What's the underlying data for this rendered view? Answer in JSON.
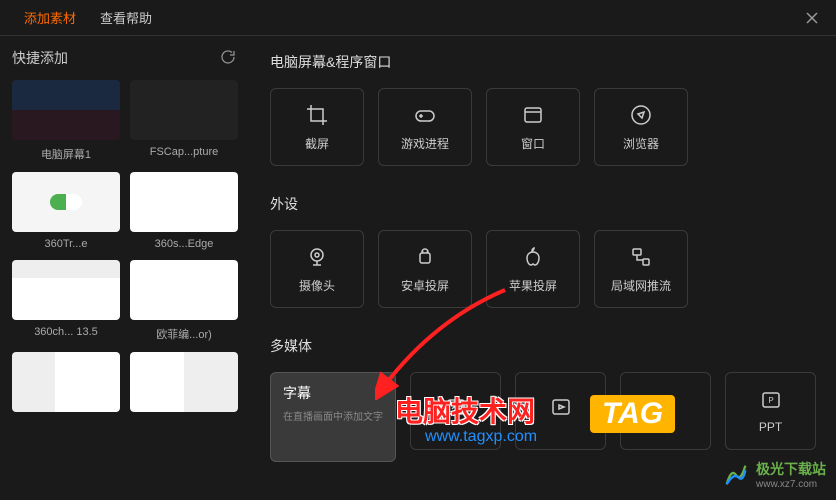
{
  "header": {
    "tab_add": "添加素材",
    "tab_help": "查看帮助"
  },
  "sidebar": {
    "title": "快捷添加",
    "items": [
      {
        "label": "电脑屏幕1"
      },
      {
        "label": "FSCap...pture"
      },
      {
        "label": "360Tr...e"
      },
      {
        "label": "360s...Edge"
      },
      {
        "label": "360ch... 13.5"
      },
      {
        "label": "欧菲编...or)"
      },
      {
        "label": ""
      },
      {
        "label": ""
      }
    ]
  },
  "sections": {
    "screen": {
      "title": "电脑屏幕&程序窗口",
      "items": [
        "截屏",
        "游戏进程",
        "窗口",
        "浏览器"
      ]
    },
    "peripheral": {
      "title": "外设",
      "items": [
        "摄像头",
        "安卓投屏",
        "苹果投屏",
        "局域网推流"
      ]
    },
    "multimedia": {
      "title": "多媒体",
      "active": {
        "label": "字幕",
        "desc": "在直播画面中添加文字"
      },
      "items": [
        "",
        "",
        "",
        "PPT"
      ]
    }
  },
  "overlay": {
    "wm_text": "电脑技术网",
    "wm_url": "www.tagxp.com",
    "tag": "TAG",
    "jg_text": "极光下载站",
    "jg_url": "www.xz7.com"
  }
}
